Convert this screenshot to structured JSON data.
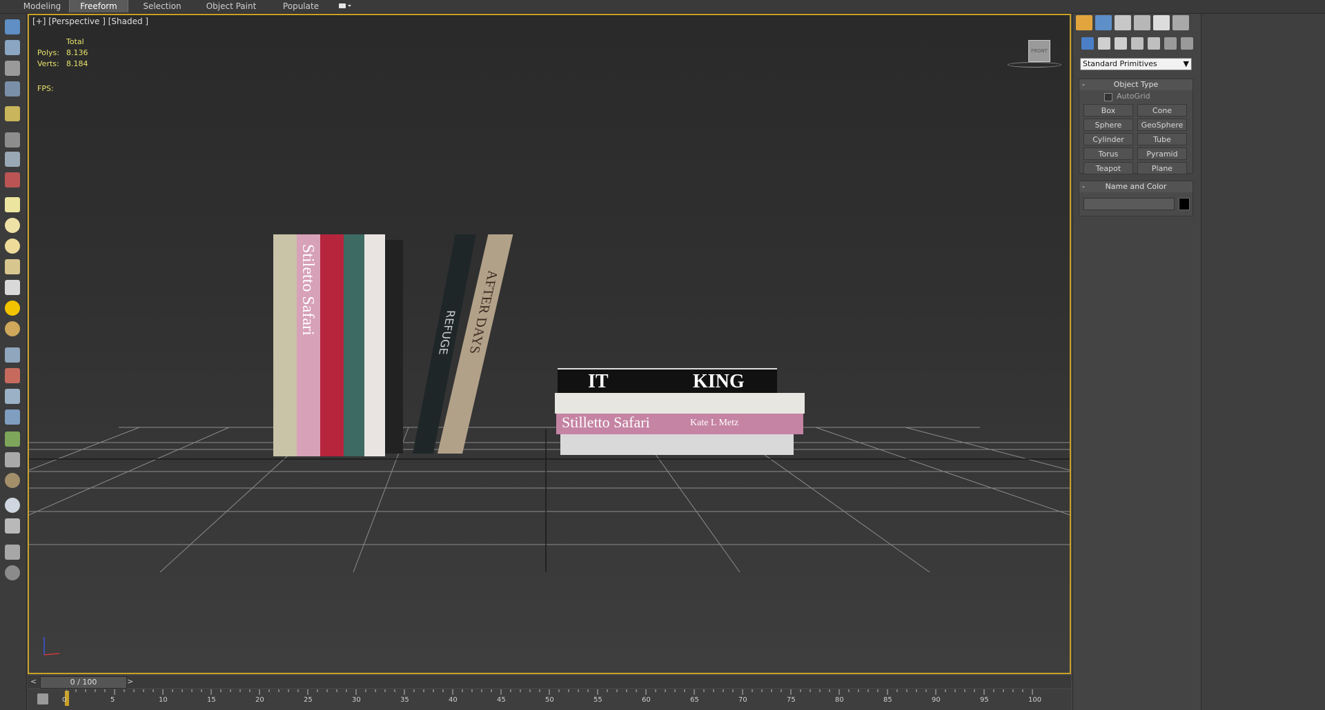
{
  "ribbon": {
    "tabs": [
      {
        "label": "Modeling",
        "active": false
      },
      {
        "label": "Freeform",
        "active": true
      },
      {
        "label": "Selection",
        "active": false
      },
      {
        "label": "Object Paint",
        "active": false
      },
      {
        "label": "Populate",
        "active": false
      }
    ]
  },
  "viewport": {
    "label": "[+] [Perspective ] [Shaded ]",
    "stats": {
      "header": "Total",
      "polys_label": "Polys:",
      "polys_value": "8.136",
      "verts_label": "Verts:",
      "verts_value": "8.184",
      "fps_label": "FPS:"
    },
    "viewcube_label": "FRONT",
    "standing_books": [
      "Stiletto Safari",
      "AFTER DAYS",
      "REFUGE"
    ],
    "stacked_books": [
      "IT",
      "KING",
      "Stilletto Safari",
      "Kate L Metz"
    ]
  },
  "command_panel": {
    "dropdown": "Standard Primitives",
    "object_type": {
      "title": "Object Type",
      "autogrid": "AutoGrid",
      "buttons": [
        "Box",
        "Cone",
        "Sphere",
        "GeoSphere",
        "Cylinder",
        "Tube",
        "Torus",
        "Pyramid",
        "Teapot",
        "Plane"
      ]
    },
    "name_color": {
      "title": "Name and Color",
      "name_value": "",
      "color": "#000000"
    }
  },
  "timeline": {
    "frame_text": "0 / 100",
    "prev": "<",
    "next": ">",
    "ticks": [
      "0",
      "5",
      "10",
      "15",
      "20",
      "25",
      "30",
      "35",
      "40",
      "45",
      "50",
      "55",
      "60",
      "65",
      "70",
      "75",
      "80",
      "85",
      "90",
      "95",
      "100"
    ]
  },
  "colors": {
    "accent": "#c9a227",
    "toolbar_bg": "#3c3c3c",
    "panel_bg": "#444444"
  }
}
